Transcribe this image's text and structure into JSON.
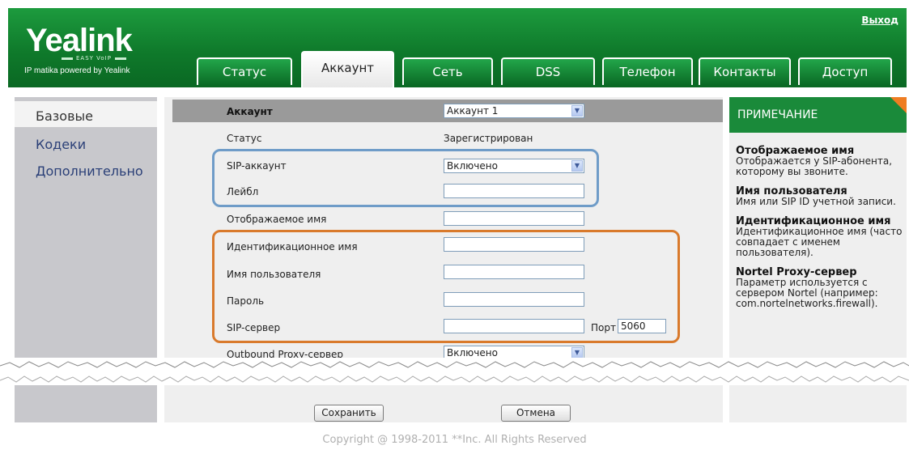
{
  "header": {
    "logo": "Yealink",
    "logo_sub": "EASY VoIP",
    "tagline": "IP matika powered by Yealink",
    "logout": "Выход",
    "tabs": [
      "Статус",
      "Аккаунт",
      "Сеть",
      "DSS",
      "Телефон",
      "Контакты",
      "Доступ"
    ],
    "active_tab": "Аккаунт",
    "brand_color": "#0f7a2b"
  },
  "sidebar": {
    "items": [
      "Базовые",
      "Кодеки",
      "Дополнительно"
    ],
    "active": "Базовые"
  },
  "form": {
    "header_label": "Аккаунт",
    "header_value": "Аккаунт 1",
    "rows": {
      "status_label": "Статус",
      "status_value": "Зарегистрирован",
      "sip_account_label": "SIP-аккаунт",
      "sip_account_value": "Включено",
      "label_label": "Лейбл",
      "label_value": "",
      "display_name_label": "Отображаемое имя",
      "display_name_value": "",
      "auth_name_label": "Идентификационное имя",
      "auth_name_value": "",
      "username_label": "Имя пользователя",
      "username_value": "",
      "password_label": "Пароль",
      "password_value": "",
      "sip_server_label": "SIP-сервер",
      "sip_server_value": "",
      "port_label": "Порт",
      "port_value": "5060",
      "outbound_label": "Outbound Proxy-сервер",
      "outbound_value": "Включено"
    },
    "highlight_colors": {
      "blue": "#6f9cc8",
      "orange": "#d97a2c"
    },
    "save_button": "Сохранить",
    "cancel_button": "Отмена"
  },
  "note": {
    "title": "ПРИМЕЧАНИЕ",
    "groups": [
      {
        "title": "Отображаемое имя",
        "text": "Отображается у SIP-абонента, которому вы звоните."
      },
      {
        "title": "Имя пользователя",
        "text": "Имя или SIP ID учетной записи."
      },
      {
        "title": "Идентификационное имя",
        "text": "Идентификационное имя (часто совпадает с именем пользователя)."
      },
      {
        "title": "Nortel Proxy-сервер",
        "text": "Параметр используется с сервером Nortel (например: com.nortelnetworks.firewall)."
      }
    ]
  },
  "footer": {
    "copyright": "Copyright @ 1998-2011 **Inc. All Rights Reserved"
  }
}
